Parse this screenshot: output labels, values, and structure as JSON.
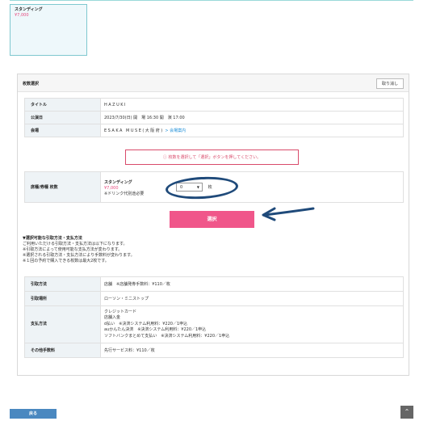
{
  "seat_card": {
    "name": "スタンディング",
    "price": "¥7,000"
  },
  "panel": {
    "title": "枚数選択",
    "cancel_label": "取り消し"
  },
  "event": {
    "title_label": "タイトル",
    "title_value": "HAZUKI",
    "date_label": "公演日",
    "date_value": "2023/7/30(日) 開　場 16:30 開　演 17:00",
    "venue_label": "会場",
    "venue_value": "ESAKA MUSE(大阪府)",
    "venue_link": "会場案内"
  },
  "notice": "ⓘ 枚数を選択して「選択」ボタンを押してください。",
  "ticket": {
    "row_label": "席種/券種 枚数",
    "name": "スタンディング",
    "price": "¥7,000",
    "note": "※ドリンク代別途必要",
    "quantity": "0",
    "unit": "枚"
  },
  "select_label": "選択",
  "payment_info": {
    "heading": "▼選択可能な引取方法・支払方法",
    "lines": [
      "ご利用いただける引取方法・支払方法は以下になります。",
      "※引取方法によって使用可能な支払方法が変わります。",
      "※選択される引取方法・支払方法により手数料が変わります。",
      "※１回の予約で購入できる枚数は最大2枚です。"
    ]
  },
  "methods": {
    "pickup_label": "引取方法",
    "pickup_value": "店舗　※店舗発券手数料：¥110／枚",
    "place_label": "引取場所",
    "place_value": "ローソン・ミニストップ",
    "pay_label": "支払方法",
    "pay_lines": [
      "クレジットカード",
      "店舗入金",
      "d払い　※決済システム利用料：¥220／1申込",
      "auかんたん決済　※決済システム利用料：¥220／1申込",
      "ソフトバンクまとめて支払い　※決済システム利用料：¥220／1申込"
    ],
    "fee_label": "その他手数料",
    "fee_value": "先行サービス料：¥110／枚"
  },
  "back_label": "戻る",
  "page_top_icon": "chevron-up-icon",
  "colors": {
    "accent_pink": "#f0568a",
    "price_pink": "#e84a7f",
    "back_blue": "#4a88c0",
    "annotation_navy": "#1f4a7a"
  }
}
